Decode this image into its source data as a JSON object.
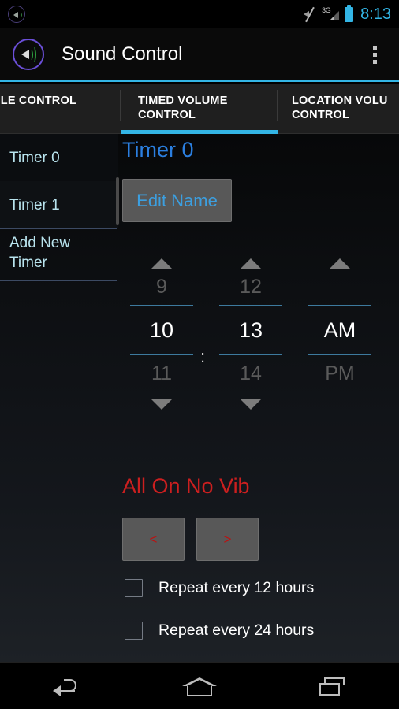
{
  "status_bar": {
    "notification_icon": "speaker-notification-icon",
    "mute_icon": "volume-muted-icon",
    "network_label": "3G",
    "signal_icon": "signal-bars-icon",
    "battery_icon": "battery-full-icon",
    "time": "8:13",
    "accent_color": "#33b5e5"
  },
  "action_bar": {
    "app_icon": "speaker-app-icon",
    "title": "Sound Control",
    "overflow_icon": "overflow-menu-icon",
    "underline_color": "#33b5e5"
  },
  "tabs": {
    "items": [
      {
        "label": "OFILE CONTROL",
        "selected": false
      },
      {
        "label": "TIMED VOLUME\nCONTROL",
        "selected": true
      },
      {
        "label": "LOCATION VOLU\nCONTROL",
        "selected": false
      }
    ],
    "indicator_color": "#33b5e5"
  },
  "sidebar": {
    "items": [
      {
        "label": "Timer 0",
        "selected": true
      },
      {
        "label": "Timer 1",
        "selected": false
      },
      {
        "label": "Add New\nTimer",
        "selected": false
      }
    ],
    "text_color": "#b9e4ee"
  },
  "main": {
    "timer_title": "Timer 0",
    "timer_title_color": "#2b7fe0",
    "edit_name_label": "Edit Name",
    "time_picker": {
      "hour": {
        "above": "9",
        "value": "10",
        "below": "11"
      },
      "separator": ":",
      "minute": {
        "above": "12",
        "value": "13",
        "below": "14"
      },
      "meridiem": {
        "above": "",
        "value": "AM",
        "below": "PM"
      },
      "line_color": "#3d7a9e"
    },
    "profile_name": "All On No Vib",
    "profile_name_color": "#cc1f1f",
    "prev_button_label": "<",
    "next_button_label": ">",
    "checkboxes": [
      {
        "label": "Repeat every 12 hours",
        "checked": false
      },
      {
        "label": "Repeat every 24 hours",
        "checked": false
      }
    ]
  },
  "nav_bar": {
    "back_icon": "back-icon",
    "home_icon": "home-icon",
    "recents_icon": "recents-icon"
  }
}
